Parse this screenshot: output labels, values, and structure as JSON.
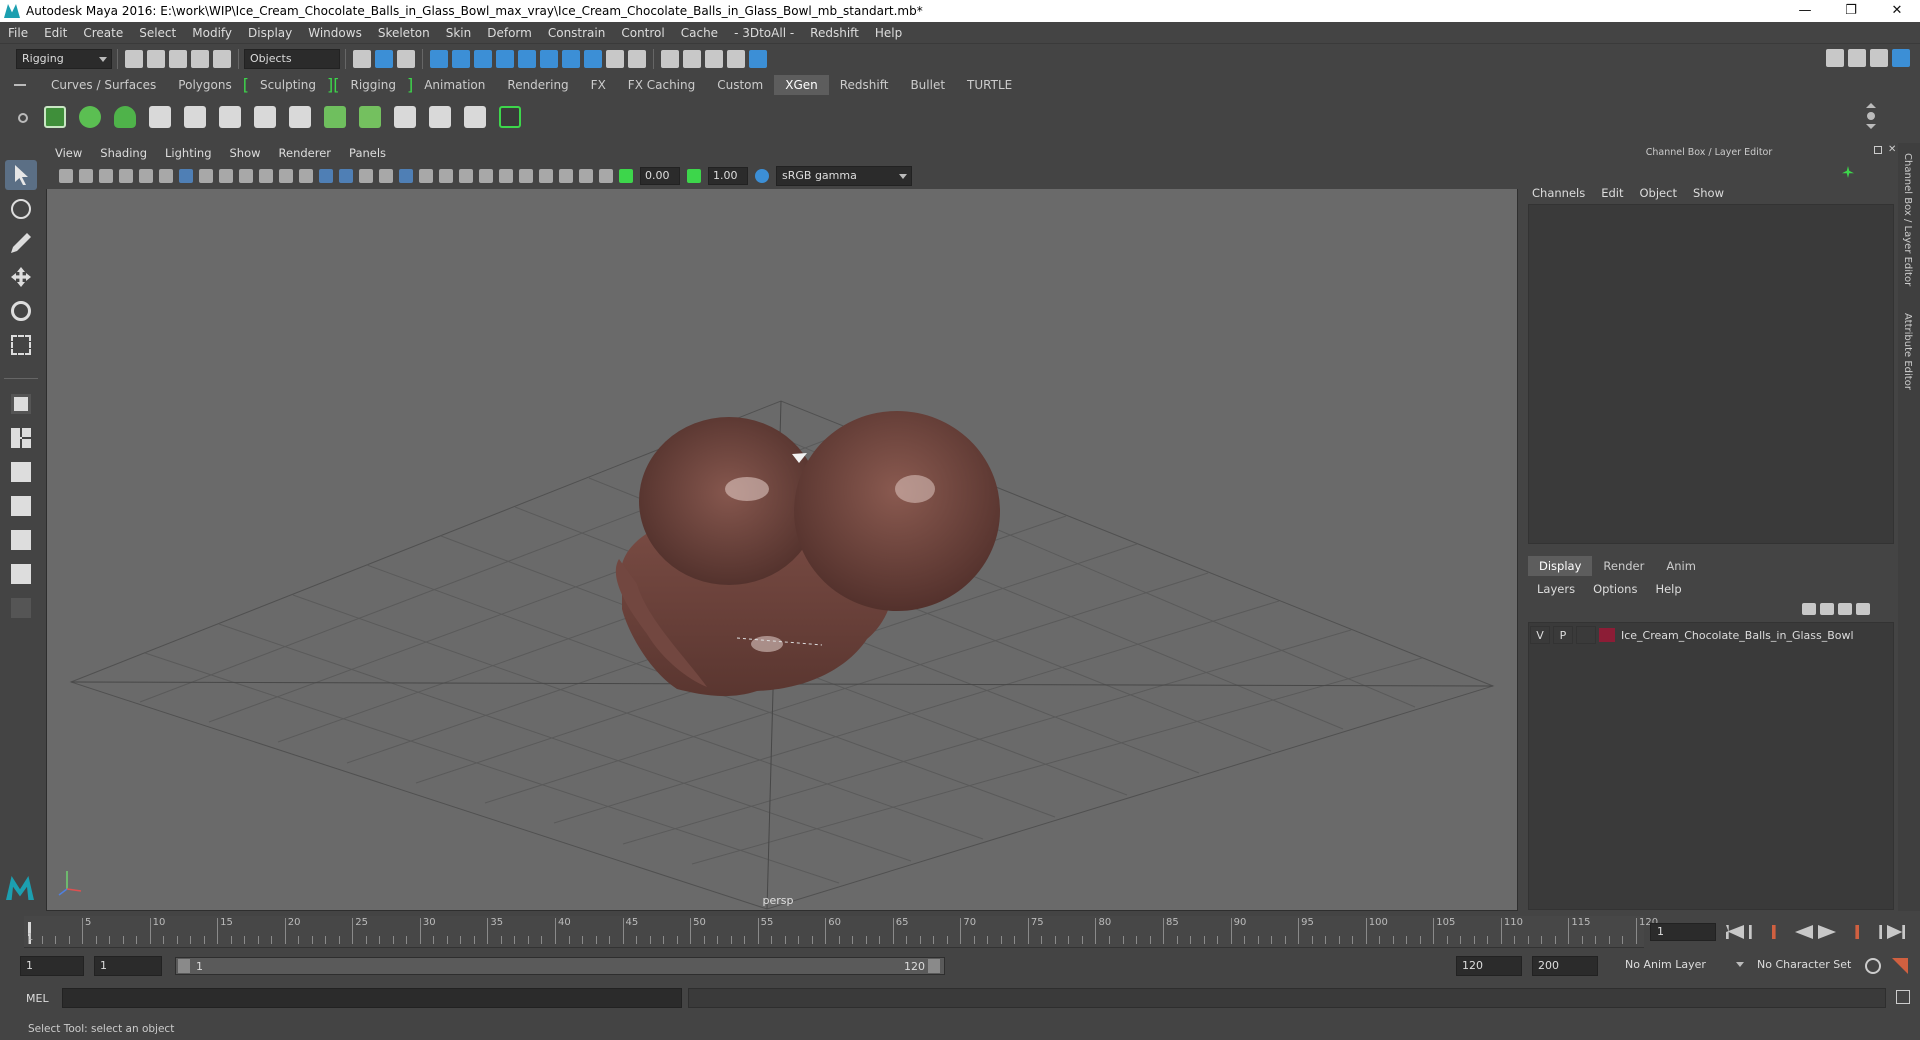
{
  "window": {
    "title": "Autodesk Maya 2016: E:\\work\\WIP\\Ice_Cream_Chocolate_Balls_in_Glass_Bowl_max_vray\\Ice_Cream_Chocolate_Balls_in_Glass_Bowl_mb_standart.mb*",
    "minimize": "—",
    "restore": "❐",
    "close": "✕"
  },
  "menubar": [
    "File",
    "Edit",
    "Create",
    "Select",
    "Modify",
    "Display",
    "Windows",
    "Skeleton",
    "Skin",
    "Deform",
    "Constrain",
    "Control",
    "Cache",
    "- 3DtoAll -",
    "Redshift",
    "Help"
  ],
  "statusline": {
    "menuset": "Rigging",
    "selection_mode": "Objects"
  },
  "shelf": {
    "tabs": [
      "Curves / Surfaces",
      "Polygons",
      "Sculpting",
      "Rigging",
      "Animation",
      "Rendering",
      "FX",
      "FX Caching",
      "Custom",
      "XGen",
      "Redshift",
      "Bullet",
      "TURTLE"
    ],
    "active_tab": "XGen"
  },
  "viewport": {
    "menu": [
      "View",
      "Shading",
      "Lighting",
      "Show",
      "Renderer",
      "Panels"
    ],
    "exposure": "0.00",
    "gamma": "1.00",
    "color_space": "sRGB gamma",
    "camera_label": "persp"
  },
  "channel_box": {
    "title": "Channel Box / Layer Editor",
    "menu": [
      "Channels",
      "Edit",
      "Object",
      "Show"
    ],
    "layer_tabs": [
      "Display",
      "Render",
      "Anim"
    ],
    "active_layer_tab": "Display",
    "layer_menu": [
      "Layers",
      "Options",
      "Help"
    ],
    "layer": {
      "visible": "V",
      "playback": "P",
      "name": "Ice_Cream_Chocolate_Balls_in_Glass_Bowl",
      "color": "#8c1d36"
    },
    "side_tabs": [
      "Channel Box / Layer Editor",
      "Attribute Editor"
    ]
  },
  "timeslider": {
    "ticks": [
      "5",
      "10",
      "15",
      "20",
      "25",
      "30",
      "35",
      "40",
      "45",
      "50",
      "55",
      "60",
      "65",
      "70",
      "75",
      "80",
      "85",
      "90",
      "95",
      "100",
      "105",
      "110",
      "115",
      "120"
    ],
    "start_label": "1",
    "current_frame": "1"
  },
  "range": {
    "start": "1",
    "playback_start": "1",
    "slider_start": "1",
    "slider_end": "120",
    "playback_end": "120",
    "end": "200",
    "anim_layer": "No Anim Layer",
    "character_set": "No Character Set"
  },
  "commandline": {
    "label": "MEL",
    "input": ""
  },
  "helpline": "Select Tool: select an object",
  "colors": {
    "accent": "#3c8fd6",
    "shelf_green": "#3dd64b",
    "chocolate": "#6b4038"
  }
}
